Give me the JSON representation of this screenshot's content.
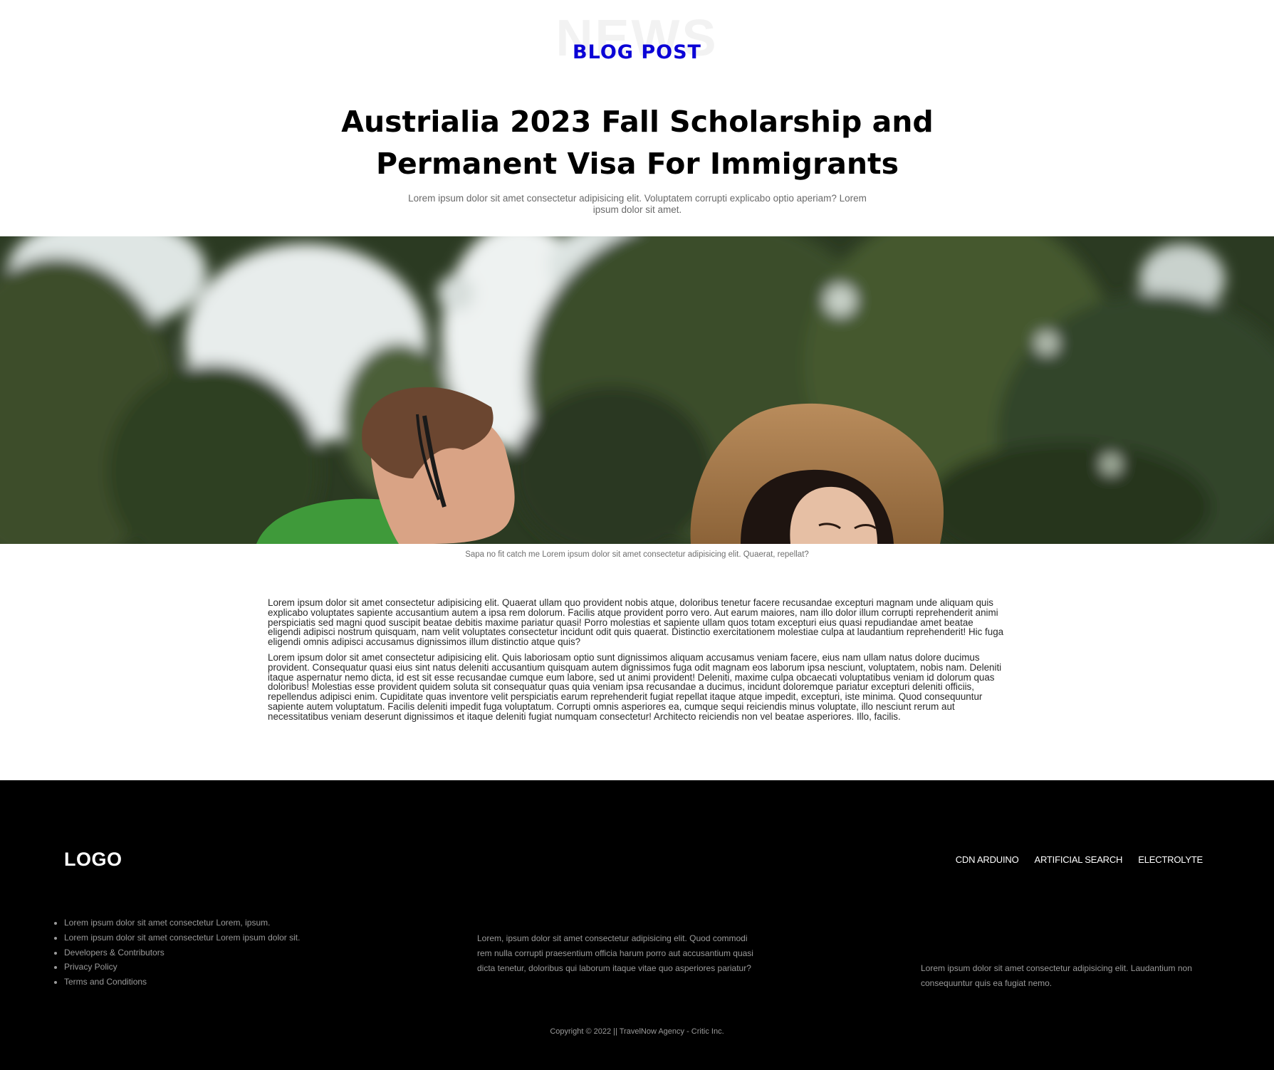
{
  "header": {
    "watermark": "NEWS",
    "kicker": "BLOG POST",
    "title": "Austrialia 2023 Fall Scholarship and Permanent Visa For Immigrants",
    "subtitle": "Lorem ipsum dolor sit amet consectetur adipisicing elit. Voluptatem corrupti explicabo optio aperiam? Lorem ipsum dolor sit amet."
  },
  "hero": {
    "image_description": "young man and woman in straw hat outdoors under trees"
  },
  "caption": "Sapa no fit catch me Lorem ipsum dolor sit amet consectetur adipisicing elit. Quaerat, repellat?",
  "article": {
    "paragraphs": [
      "Lorem ipsum dolor sit amet consectetur adipisicing elit. Quaerat ullam quo provident nobis atque, doloribus tenetur facere recusandae excepturi magnam unde aliquam quis explicabo voluptates sapiente accusantium autem a ipsa rem dolorum. Facilis atque provident porro vero. Aut earum maiores, nam illo dolor illum corrupti reprehenderit animi perspiciatis sed magni quod suscipit beatae debitis maxime pariatur quasi! Porro molestias et sapiente ullam quos totam excepturi eius quasi repudiandae amet beatae eligendi adipisci nostrum quisquam, nam velit voluptates consectetur incidunt odit quis quaerat. Distinctio exercitationem molestiae culpa at laudantium reprehenderit! Hic fuga eligendi omnis adipisci accusamus dignissimos illum distinctio atque quis?",
      "Lorem ipsum dolor sit amet consectetur adipisicing elit. Quis laboriosam optio sunt dignissimos aliquam accusamus veniam facere, eius nam ullam natus dolore ducimus provident. Consequatur quasi eius sint natus deleniti accusantium quisquam autem dignissimos fuga odit magnam eos laborum ipsa nesciunt, voluptatem, nobis nam. Deleniti itaque aspernatur nemo dicta, id est sit esse recusandae cumque eum labore, sed ut animi provident! Deleniti, maxime culpa obcaecati voluptatibus veniam id dolorum quas doloribus! Molestias esse provident quidem soluta sit consequatur quas quia veniam ipsa recusandae a ducimus, incidunt doloremque pariatur excepturi deleniti officiis, repellendus adipisci enim. Cupiditate quas inventore velit perspiciatis earum reprehenderit fugiat repellat itaque atque impedit, excepturi, iste minima. Quod consequuntur sapiente autem voluptatum. Facilis deleniti impedit fuga voluptatum. Corrupti omnis asperiores ea, cumque sequi reiciendis minus voluptate, illo nesciunt rerum aut necessitatibus veniam deserunt dignissimos et itaque deleniti fugiat numquam consectetur! Architecto reiciendis non vel beatae asperiores. Illo, facilis."
    ]
  },
  "footer": {
    "logo": "LOGO",
    "nav": [
      "CDN ARDUINO",
      "ARTIFICIAL SEARCH",
      "ELECTROLYTE"
    ],
    "links": [
      "Lorem ipsum dolor sit amet consectetur Lorem, ipsum.",
      "Lorem ipsum dolor sit amet consectetur Lorem ipsum dolor sit.",
      "Developers & Contributors",
      "Privacy Policy",
      "Terms and Conditions"
    ],
    "middle_text": "Lorem, ipsum dolor sit amet consectetur adipisicing elit. Quod commodi rem nulla corrupti praesentium officia harum porro aut accusantium quasi dicta tenetur, doloribus qui laborum itaque vitae quo asperiores pariatur?",
    "right_text": "Lorem ipsum dolor sit amet consectetur adipisicing elit. Laudantium non consequuntur quis ea fugiat nemo.",
    "copyright": "Copyright © 2022 || TravelNow Agency - Critic Inc."
  }
}
